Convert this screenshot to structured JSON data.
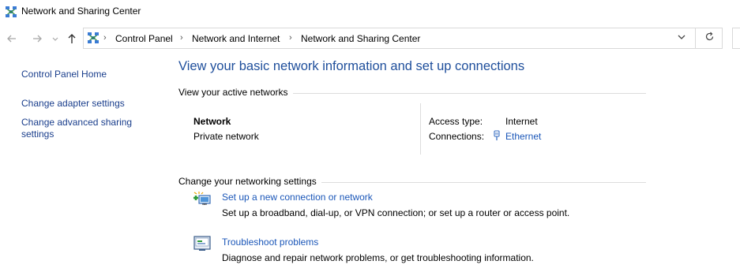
{
  "window": {
    "title": "Network and Sharing Center"
  },
  "navigation": {
    "back_icon": "arrow-left-icon",
    "forward_icon": "arrow-right-icon",
    "recent_icon": "chevron-down-icon",
    "up_icon": "arrow-up-icon",
    "breadcrumb": [
      "Control Panel",
      "Network and Internet",
      "Network and Sharing Center"
    ],
    "separator": "›",
    "dropdown_icon": "chevron-down-icon",
    "refresh_icon": "refresh-icon"
  },
  "sidebar": {
    "items": [
      {
        "label": "Control Panel Home"
      },
      {
        "label": "Change adapter settings"
      },
      {
        "label": "Change advanced sharing settings"
      }
    ]
  },
  "main": {
    "heading": "View your basic network information and set up connections",
    "active_networks": {
      "section_label": "View your active networks",
      "network_name": "Network",
      "network_category": "Private network",
      "access_type_label": "Access type:",
      "access_type_value": "Internet",
      "connections_label": "Connections:",
      "connection_name": "Ethernet",
      "connection_icon": "ethernet-icon"
    },
    "settings": {
      "section_label": "Change your networking settings",
      "tasks": [
        {
          "title": "Set up a new connection or network",
          "description": "Set up a broadband, dial-up, or VPN connection; or set up a router or access point.",
          "icon": "new-connection-icon"
        },
        {
          "title": "Troubleshoot problems",
          "description": "Diagnose and repair network problems, or get troubleshooting information.",
          "icon": "troubleshoot-icon"
        }
      ]
    }
  },
  "colors": {
    "link": "#1a56b8",
    "heading": "#1e4e9b",
    "border": "#d9d9d9"
  }
}
